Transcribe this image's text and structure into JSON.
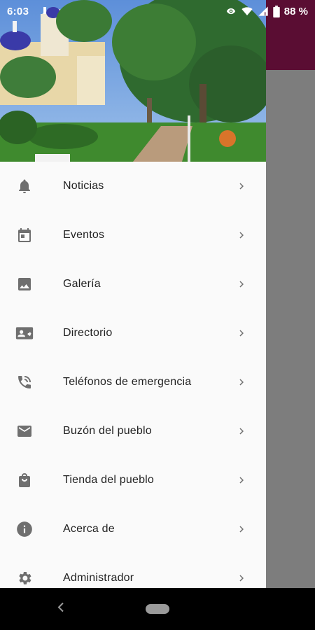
{
  "status_bar": {
    "time": "6:03",
    "battery": "88 %"
  },
  "menu": {
    "items": [
      {
        "label": "Noticias",
        "icon": "bell-icon"
      },
      {
        "label": "Eventos",
        "icon": "calendar-icon"
      },
      {
        "label": "Galería",
        "icon": "image-icon"
      },
      {
        "label": "Directorio",
        "icon": "contact-card-icon"
      },
      {
        "label": "Teléfonos de emergencia",
        "icon": "phone-call-icon"
      },
      {
        "label": "Buzón del pueblo",
        "icon": "mail-icon"
      },
      {
        "label": "Tienda del pueblo",
        "icon": "shopping-bag-icon"
      },
      {
        "label": "Acerca de",
        "icon": "info-icon"
      },
      {
        "label": "Administrador",
        "icon": "gear-icon"
      }
    ]
  },
  "colors": {
    "app_bar": "#5a0d33",
    "icon": "#6f6f6f",
    "text": "#222222"
  }
}
